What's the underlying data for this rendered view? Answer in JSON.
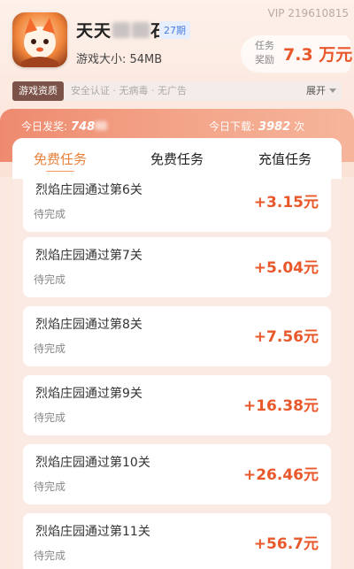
{
  "header": {
    "game_title_part1": "天天",
    "game_title_part2": "石",
    "period_tag": "27期",
    "vip_id": "VIP 219610815",
    "size_text": "游戏大小:   54MB",
    "reward_label": "任务 奖励",
    "reward_value": "7.3  万元"
  },
  "info_bar": {
    "tag": "游戏资质",
    "text": "安全认证 · 无病毒 · 无广告",
    "expand": "展开"
  },
  "stats": {
    "today_payout_label": "今日发奖:",
    "today_payout_value": "748",
    "today_download_label": "今日下载:",
    "today_download_value": "3982",
    "today_download_unit": "次"
  },
  "tabs": [
    {
      "label": "免费任务"
    },
    {
      "label": "免费任务"
    },
    {
      "label": "充值任务"
    }
  ],
  "tasks": [
    {
      "title": "烈焰庄园通过第6关",
      "status": "待完成",
      "reward": "+3.15元"
    },
    {
      "title": "烈焰庄园通过第7关",
      "status": "待完成",
      "reward": "+5.04元"
    },
    {
      "title": "烈焰庄园通过第8关",
      "status": "待完成",
      "reward": "+7.56元"
    },
    {
      "title": "烈焰庄园通过第9关",
      "status": "待完成",
      "reward": "+16.38元"
    },
    {
      "title": "烈焰庄园通过第10关",
      "status": "待完成",
      "reward": "+26.46元"
    },
    {
      "title": "烈焰庄园通过第11关",
      "status": "待完成",
      "reward": "+56.7元"
    }
  ],
  "colors": {
    "accent": "#e8582b",
    "tab_active": "#e8823b",
    "stats_bar": "#ee8a6f"
  }
}
